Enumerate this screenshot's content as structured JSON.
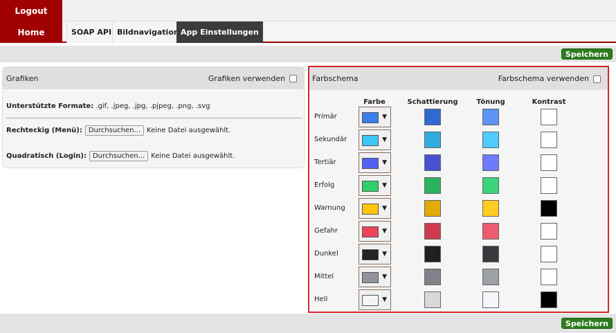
{
  "nav": {
    "logout": "Logout",
    "home": "Home",
    "tabs": [
      "SOAP API",
      "Bildnavigation",
      "App Einstellungen"
    ]
  },
  "save_label": "Speichern",
  "grafiken": {
    "title": "Grafiken",
    "use_label": "Grafiken verwenden",
    "formats_label": "Unterstützte Formate:",
    "formats_value": ".gif, .jpeg, .jpg, .pjpeg, .png, .svg",
    "rect_label": "Rechteckig (Menü):",
    "square_label": "Quadratisch (Login):",
    "browse": "Durchsuchen...",
    "no_file": "Keine Datei ausgewählt."
  },
  "farbschema": {
    "title": "Farbschema",
    "use_label": "Farbschema verwenden",
    "columns": [
      "Farbe",
      "Schattierung",
      "Tönung",
      "Kontrast"
    ],
    "rows": [
      {
        "label": "Primär",
        "color": "#3b7ded",
        "shade": "#2f6ad0",
        "tint": "#5b94f5",
        "contrast": "#ffffff"
      },
      {
        "label": "Sekundär",
        "color": "#3cc8f5",
        "shade": "#31ace0",
        "tint": "#4fcbff",
        "contrast": "#ffffff"
      },
      {
        "label": "Tertiär",
        "color": "#5361f2",
        "shade": "#4851d3",
        "tint": "#6d7bfd",
        "contrast": "#ffffff"
      },
      {
        "label": "Erfolg",
        "color": "#2fd06a",
        "shade": "#29b45d",
        "tint": "#3bd47c",
        "contrast": "#ffffff"
      },
      {
        "label": "Warnung",
        "color": "#ffc60a",
        "shade": "#e0ac0a",
        "tint": "#ffcd22",
        "contrast": "#000000"
      },
      {
        "label": "Gefahr",
        "color": "#eb445a",
        "shade": "#cf3a4f",
        "tint": "#ee5b70",
        "contrast": "#ffffff"
      },
      {
        "label": "Dunkel",
        "color": "#222428",
        "shade": "#1e2023",
        "tint": "#383a3e",
        "contrast": "#ffffff"
      },
      {
        "label": "Mittel",
        "color": "#92949c",
        "shade": "#808289",
        "tint": "#9da0a6",
        "contrast": "#ffffff"
      },
      {
        "label": "Hell",
        "color": "#f4f5f8",
        "shade": "#d7d8da",
        "tint": "#f5f6f9",
        "contrast": "#000000"
      }
    ]
  }
}
